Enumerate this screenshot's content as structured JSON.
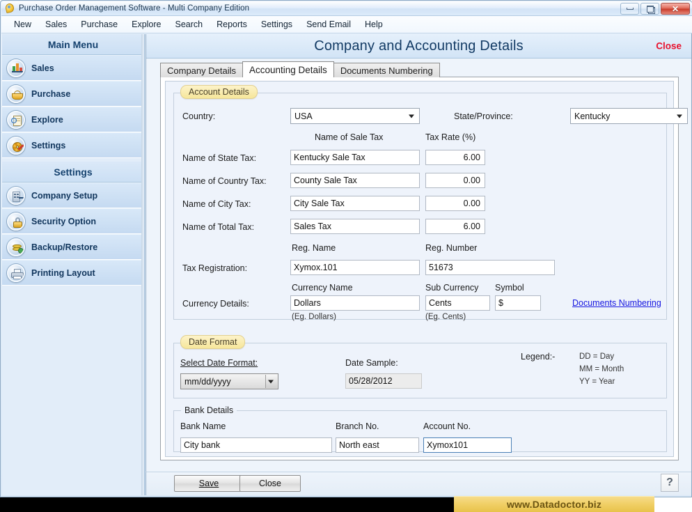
{
  "window": {
    "title": "Purchase Order Management Software - Multi Company Edition",
    "icon": "app-moon-icon",
    "buttons": {
      "minimize": "minimize-icon",
      "maximize": "maximize-icon",
      "close": "✕"
    }
  },
  "menubar": {
    "items": [
      "New",
      "Sales",
      "Purchase",
      "Explore",
      "Search",
      "Reports",
      "Settings",
      "Send Email",
      "Help"
    ]
  },
  "sidebar": {
    "main_menu": {
      "header": "Main Menu",
      "items": [
        {
          "label": "Sales",
          "icon": "chart-icon"
        },
        {
          "label": "Purchase",
          "icon": "basket-icon"
        },
        {
          "label": "Explore",
          "icon": "document-search-icon"
        },
        {
          "label": "Settings",
          "icon": "gear-icon"
        }
      ]
    },
    "settings": {
      "header": "Settings",
      "items": [
        {
          "label": "Company Setup",
          "icon": "building-icon"
        },
        {
          "label": "Security Option",
          "icon": "padlock-icon"
        },
        {
          "label": "Backup/Restore",
          "icon": "database-recycle-icon"
        },
        {
          "label": "Printing Layout",
          "icon": "printer-icon"
        }
      ]
    }
  },
  "content": {
    "title": "Company and Accounting Details",
    "close_label": "Close",
    "tabs": [
      {
        "label": "Company Details",
        "active": false
      },
      {
        "label": "Accounting Details",
        "active": true
      },
      {
        "label": "Documents Numbering",
        "active": false
      }
    ]
  },
  "account_details": {
    "legend": "Account Details",
    "country_label": "Country:",
    "country_value": "USA",
    "state_label": "State/Province:",
    "state_value": "Kentucky",
    "col_name_header": "Name of Sale Tax",
    "col_rate_header": "Tax Rate (%)",
    "rows": [
      {
        "label": "Name of State Tax:",
        "name": "Kentucky Sale Tax",
        "rate": "6.00"
      },
      {
        "label": "Name of Country Tax:",
        "name": "County Sale Tax",
        "rate": "0.00"
      },
      {
        "label": "Name of City Tax:",
        "name": "City Sale Tax",
        "rate": "0.00"
      },
      {
        "label": "Name of Total Tax:",
        "name": "Sales Tax",
        "rate": "6.00"
      }
    ],
    "tax_registration": {
      "label": "Tax Registration:",
      "reg_name_header": "Reg. Name",
      "reg_number_header": "Reg. Number",
      "reg_name": "Xymox.101",
      "reg_number": "51673"
    },
    "currency": {
      "label": "Currency Details:",
      "currency_name_header": "Currency Name",
      "sub_currency_header": "Sub Currency",
      "symbol_header": "Symbol",
      "currency_name": "Dollars",
      "sub_currency": "Cents",
      "symbol": "$",
      "currency_hint": "(Eg. Dollars)",
      "sub_currency_hint": "(Eg. Cents)"
    },
    "documents_numbering_link": "Documents Numbering"
  },
  "date_format": {
    "legend": "Date Format",
    "select_label": "Select Date Format:",
    "select_value": "mm/dd/yyyy",
    "sample_label": "Date Sample:",
    "sample_value": "05/28/2012",
    "legend_title": "Legend:-",
    "legend_lines": [
      "DD = Day",
      "MM = Month",
      "YY = Year"
    ]
  },
  "bank_details": {
    "legend": "Bank Details",
    "bank_name_label": "Bank Name",
    "branch_no_label": "Branch No.",
    "account_no_label": "Account No.",
    "bank_name": "City bank",
    "branch_no": "North east",
    "account_no": "Xymox101"
  },
  "footer": {
    "save_label": "Save",
    "close_label": "Close",
    "help_icon": "?",
    "watermark": "www.Datadoctor.biz"
  },
  "colors": {
    "title_blue": "#123a64",
    "close_red": "#e8112d",
    "link_blue": "#1414e0",
    "accent_yellow": "#f6e69a",
    "sidebar_blue": "#c5daf1",
    "watermark_gold": "#f0cf65"
  }
}
